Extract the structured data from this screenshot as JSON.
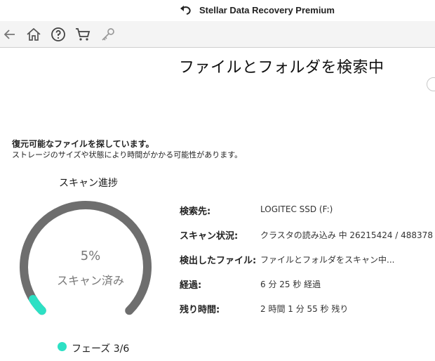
{
  "window": {
    "title": "Stellar Data Recovery Premium",
    "logo_icon": "stellar-logo-icon"
  },
  "toolbar": {
    "icons": [
      "back-arrow-icon",
      "home-icon",
      "help-icon",
      "cart-icon",
      "key-icon"
    ]
  },
  "page": {
    "title": "ファイルとフォルダを検索中",
    "message_line1": "復元可能なファイルを探しています。",
    "message_line2": "ストレージのサイズや状態により時間がかかる可能性があります。"
  },
  "progress": {
    "heading": "スキャン進捗",
    "percent_text": "5%",
    "percent_value": 5,
    "status_text": "スキャン済み",
    "phase_text": "フェーズ 3/6",
    "accent_color": "#2de0c4",
    "track_color": "#6e6e6e"
  },
  "details": [
    {
      "label": "検索先:",
      "value": "LOGITEC SSD (F:)"
    },
    {
      "label": "スキャン状況:",
      "value": "クラスタの読み込み 中 26215424 / 488378"
    },
    {
      "label": "検出したファイル:",
      "value": "ファイルとフォルダをスキャン中..."
    },
    {
      "label": "経過:",
      "value": "6 分 25 秒 経過"
    },
    {
      "label": "残り時間:",
      "value": "2 時間 1 分 55 秒 残り"
    }
  ]
}
